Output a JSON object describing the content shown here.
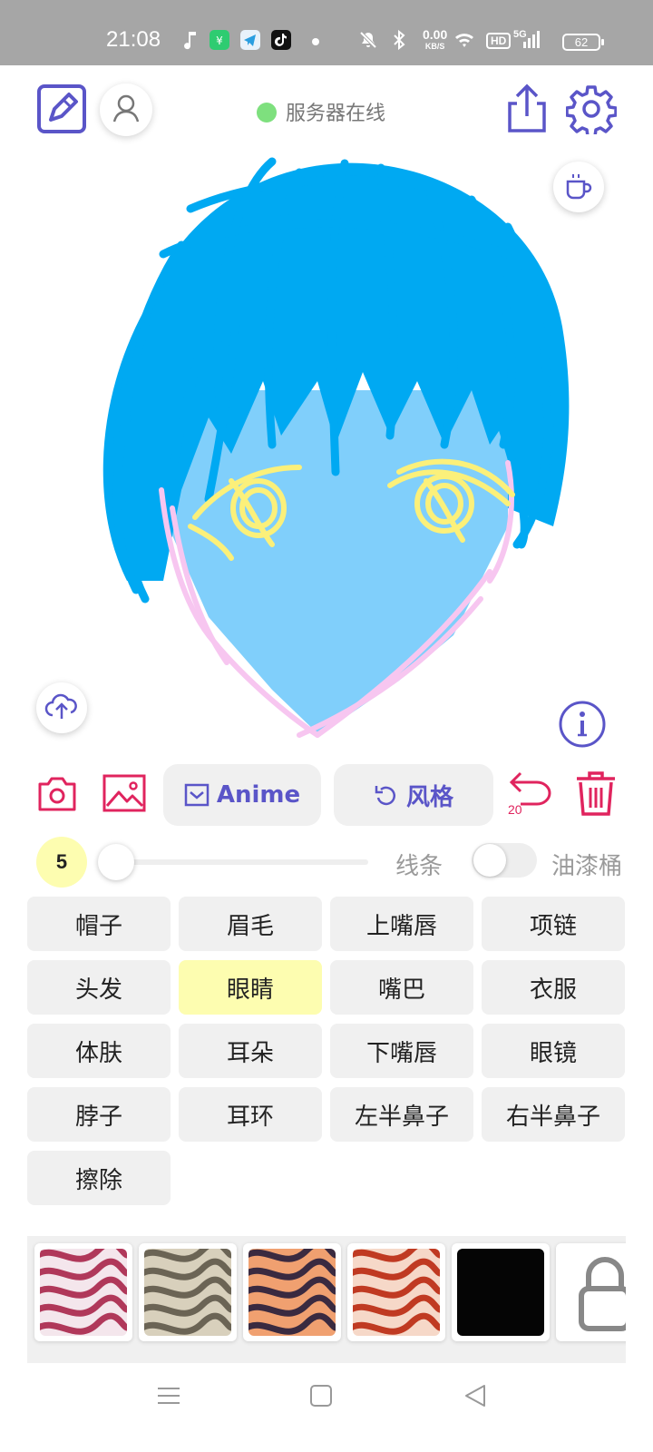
{
  "status_bar": {
    "time": "21:08",
    "net_speed_value": "0.00",
    "net_speed_unit": "KB/S",
    "hd_badge": "HD",
    "network_type": "5G",
    "battery": "62"
  },
  "header": {
    "server_status": "服务器在线",
    "server_status_color": "#7ee07e",
    "icons": [
      "edit-icon",
      "user-icon",
      "share-icon",
      "gear-icon",
      "coffee-icon"
    ]
  },
  "canvas": {
    "icons": [
      "cloud-upload-icon",
      "info-icon"
    ]
  },
  "toolbar": {
    "anime_label": "Anime",
    "style_label": "风格",
    "undo_count": "20",
    "accent_color": "#e0245e",
    "brand_color": "#5a55c8"
  },
  "brush": {
    "size": "5",
    "line_label": "线条",
    "bucket_label": "油漆桶",
    "bucket_enabled": false
  },
  "parts": [
    {
      "label": "帽子",
      "active": false
    },
    {
      "label": "眉毛",
      "active": false
    },
    {
      "label": "上嘴唇",
      "active": false
    },
    {
      "label": "项链",
      "active": false
    },
    {
      "label": "头发",
      "active": false
    },
    {
      "label": "眼睛",
      "active": true
    },
    {
      "label": "嘴巴",
      "active": false
    },
    {
      "label": "衣服",
      "active": false
    },
    {
      "label": "体肤",
      "active": false
    },
    {
      "label": "耳朵",
      "active": false
    },
    {
      "label": "下嘴唇",
      "active": false
    },
    {
      "label": "眼镜",
      "active": false
    },
    {
      "label": "脖子",
      "active": false
    },
    {
      "label": "耳环",
      "active": false
    },
    {
      "label": "左半鼻子",
      "active": false
    },
    {
      "label": "右半鼻子",
      "active": false
    },
    {
      "label": "擦除",
      "active": false
    }
  ],
  "styles": [
    {
      "name": "style-thumb-1",
      "base": "#f4e6ec",
      "stroke": "#b0385a"
    },
    {
      "name": "style-thumb-2",
      "base": "#d8d0bc",
      "stroke": "#6b6455"
    },
    {
      "name": "style-thumb-3",
      "base": "#f0a070",
      "stroke": "#3a2a40"
    },
    {
      "name": "style-thumb-4",
      "base": "#f6d8c8",
      "stroke": "#c03a22"
    },
    {
      "name": "style-thumb-5",
      "base": "#050505",
      "stroke": "#050505"
    },
    {
      "name": "style-locked",
      "base": "#ffffff",
      "stroke": "#888888"
    }
  ]
}
